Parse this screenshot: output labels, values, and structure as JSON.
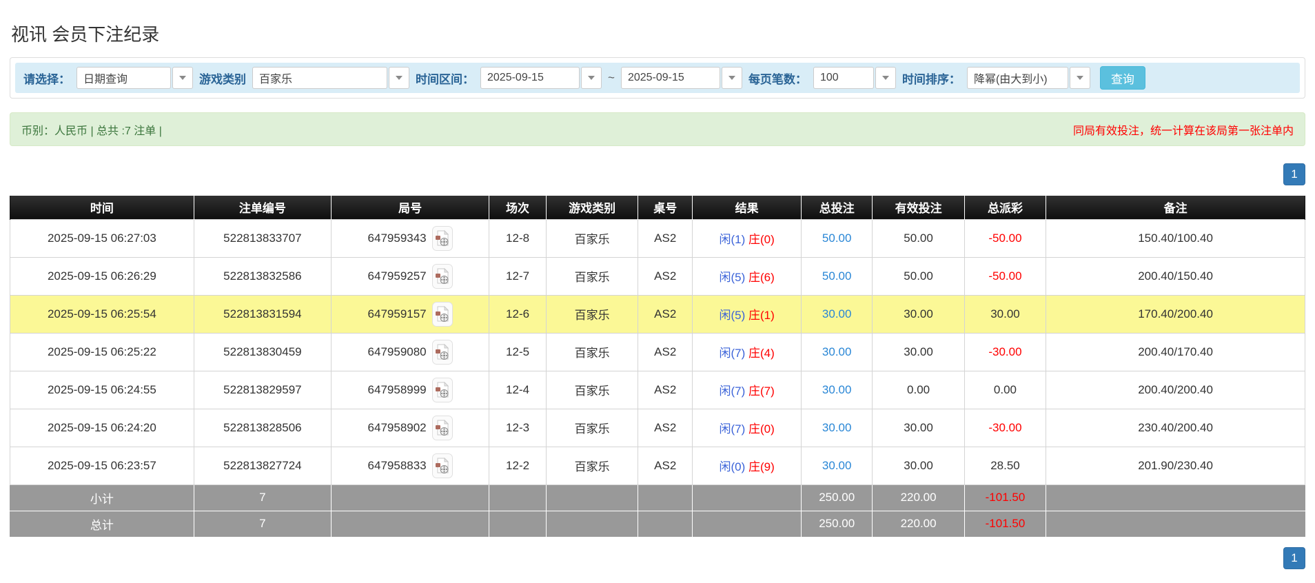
{
  "page": {
    "title": "视讯 会员下注纪录"
  },
  "filters": {
    "select_label": "请选择：",
    "select_value": "日期查询",
    "game_label": "游戏类别",
    "game_value": "百家乐",
    "range_label": "时间区间：",
    "date_from": "2025-09-15",
    "range_separator": "~",
    "date_to": "2025-09-15",
    "per_page_label": "每页笔数：",
    "per_page_value": "100",
    "sort_label": "时间排序：",
    "sort_value": "降幂(由大到小)",
    "search_button": "查询"
  },
  "summary": {
    "currency_info": "币别：人民币 | 总共 :7 注单 |",
    "notice": "同局有效投注，统一计算在该局第一张注单内"
  },
  "pagination": {
    "page": "1"
  },
  "table": {
    "headers": [
      "时间",
      "注单编号",
      "局号",
      "场次",
      "游戏类别",
      "桌号",
      "结果",
      "总投注",
      "有效投注",
      "总派彩",
      "备注"
    ],
    "rows": [
      {
        "time": "2025-09-15 06:27:03",
        "bet_id": "522813833707",
        "round_id": "647959343",
        "session": "12-8",
        "game": "百家乐",
        "table_no": "AS2",
        "result_player": "闲(1)",
        "result_banker": "庄(0)",
        "total_bet": "50.00",
        "valid_bet": "50.00",
        "payout": "-50.00",
        "note": "150.40/100.40",
        "highlighted": false
      },
      {
        "time": "2025-09-15 06:26:29",
        "bet_id": "522813832586",
        "round_id": "647959257",
        "session": "12-7",
        "game": "百家乐",
        "table_no": "AS2",
        "result_player": "闲(5)",
        "result_banker": "庄(6)",
        "total_bet": "50.00",
        "valid_bet": "50.00",
        "payout": "-50.00",
        "note": "200.40/150.40",
        "highlighted": false
      },
      {
        "time": "2025-09-15 06:25:54",
        "bet_id": "522813831594",
        "round_id": "647959157",
        "session": "12-6",
        "game": "百家乐",
        "table_no": "AS2",
        "result_player": "闲(5)",
        "result_banker": "庄(1)",
        "total_bet": "30.00",
        "valid_bet": "30.00",
        "payout": "30.00",
        "note": "170.40/200.40",
        "highlighted": true
      },
      {
        "time": "2025-09-15 06:25:22",
        "bet_id": "522813830459",
        "round_id": "647959080",
        "session": "12-5",
        "game": "百家乐",
        "table_no": "AS2",
        "result_player": "闲(7)",
        "result_banker": "庄(4)",
        "total_bet": "30.00",
        "valid_bet": "30.00",
        "payout": "-30.00",
        "note": "200.40/170.40",
        "highlighted": false
      },
      {
        "time": "2025-09-15 06:24:55",
        "bet_id": "522813829597",
        "round_id": "647958999",
        "session": "12-4",
        "game": "百家乐",
        "table_no": "AS2",
        "result_player": "闲(7)",
        "result_banker": "庄(7)",
        "total_bet": "30.00",
        "valid_bet": "0.00",
        "payout": "0.00",
        "note": "200.40/200.40",
        "highlighted": false
      },
      {
        "time": "2025-09-15 06:24:20",
        "bet_id": "522813828506",
        "round_id": "647958902",
        "session": "12-3",
        "game": "百家乐",
        "table_no": "AS2",
        "result_player": "闲(7)",
        "result_banker": "庄(0)",
        "total_bet": "30.00",
        "valid_bet": "30.00",
        "payout": "-30.00",
        "note": "230.40/200.40",
        "highlighted": false
      },
      {
        "time": "2025-09-15 06:23:57",
        "bet_id": "522813827724",
        "round_id": "647958833",
        "session": "12-2",
        "game": "百家乐",
        "table_no": "AS2",
        "result_player": "闲(0)",
        "result_banker": "庄(9)",
        "total_bet": "30.00",
        "valid_bet": "30.00",
        "payout": "28.50",
        "note": "201.90/230.40",
        "highlighted": false
      }
    ],
    "subtotal": {
      "label": "小计",
      "count": "7",
      "total_bet": "250.00",
      "valid_bet": "220.00",
      "payout": "-101.50"
    },
    "total": {
      "label": "总计",
      "count": "7",
      "total_bet": "250.00",
      "valid_bet": "220.00",
      "payout": "-101.50"
    }
  },
  "colors": {
    "filter_bar_bg": "#d9edf7",
    "filter_label": "#2a6496",
    "search_button_bg": "#5bc0de",
    "summary_green_bg": "#dff0d8",
    "summary_green_text": "#3c763d",
    "notice_red": "#ff0000",
    "header_black": "#1a1a1a",
    "highlight_yellow": "#fbf896",
    "subtotal_gray": "#999999",
    "link_blue": "#2a87d6",
    "player_blue": "#3a62d8",
    "banker_red": "#ff0000",
    "pager_blue": "#337ab7"
  }
}
